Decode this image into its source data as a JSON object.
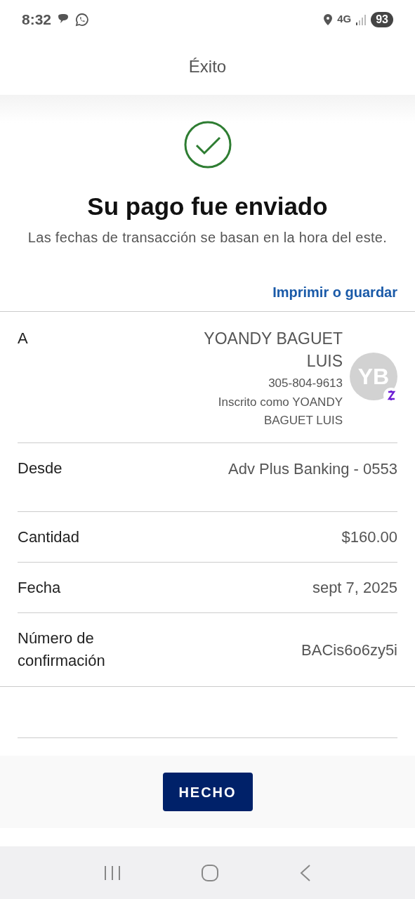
{
  "status_bar": {
    "time": "8:32",
    "network": "4G",
    "battery": "93"
  },
  "header": {
    "title": "Éxito"
  },
  "result": {
    "title": "Su pago fue enviado",
    "subtitle": "Las fechas de transacción se basan en la hora del este.",
    "link": "Imprimir o guardar"
  },
  "details": [
    {
      "kind": "recipient",
      "label": "A",
      "value": "YOANDY BAGUET LUIS",
      "phone": "305-804-9613",
      "enrolled": "Inscrito como YOANDY BAGUET LUIS",
      "initials": "YB"
    },
    {
      "kind": "plain",
      "label": "Desde",
      "value": "Adv Plus Banking - 0553"
    },
    {
      "kind": "plain",
      "label": "Cantidad",
      "value": "$160.00"
    },
    {
      "kind": "plain",
      "label": "Fecha",
      "value": "sept 7, 2025"
    },
    {
      "kind": "plain",
      "label": "Número de confirmación",
      "value": "BACis6o6zy5i"
    }
  ],
  "footer": {
    "button": "HECHO"
  }
}
